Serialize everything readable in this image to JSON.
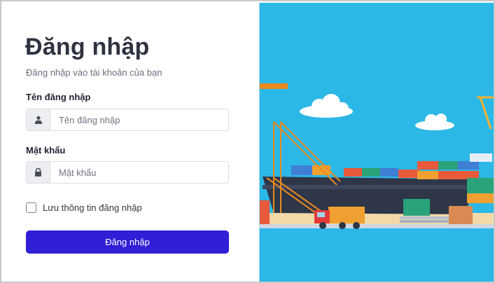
{
  "login": {
    "title": "Đăng nhập",
    "subtitle": "Đăng nhập vào tài khoản của bạn",
    "username_label": "Tên đăng nhập",
    "username_placeholder": "Tên đăng nhập",
    "username_icon": "user-icon",
    "password_label": "Mật khẩu",
    "password_placeholder": "Mật khẩu",
    "password_icon": "lock-icon",
    "remember_label": "Lưu thông tin đăng nhập",
    "remember_checked": false,
    "submit_label": "Đăng nhập"
  },
  "theme": {
    "primary": "#2f1fd6",
    "illustration_sky": "#2cb8e6"
  }
}
